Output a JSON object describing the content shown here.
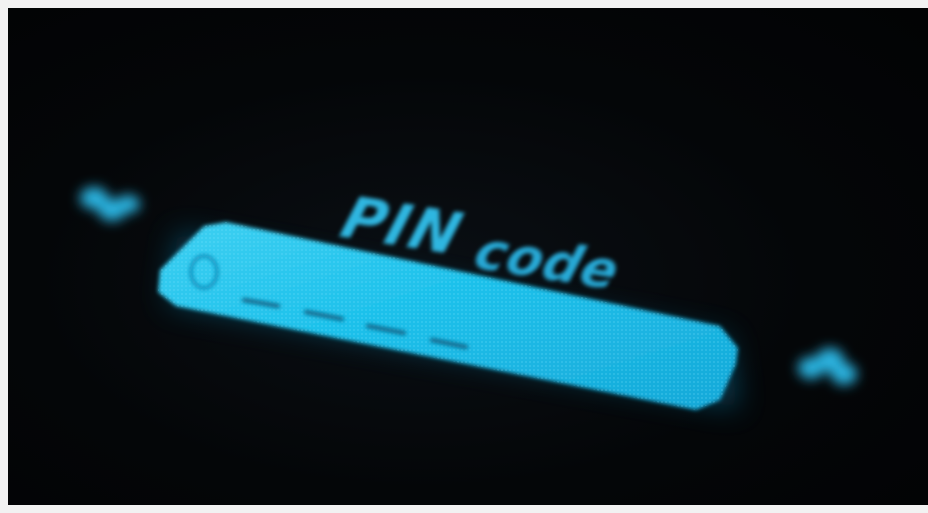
{
  "display": {
    "heading_bold": "PIN",
    "heading_light": "code",
    "pin_entry": {
      "digit_slots": 4,
      "entered_digits": 0
    },
    "glow_color": "#1fc0e8",
    "text_color": "#2fb6e0",
    "background_color": "#030507"
  },
  "icons": {
    "left_indicator": "led-indicator-icon",
    "right_indicator": "led-indicator-icon",
    "field_indicator": "circle-icon"
  }
}
